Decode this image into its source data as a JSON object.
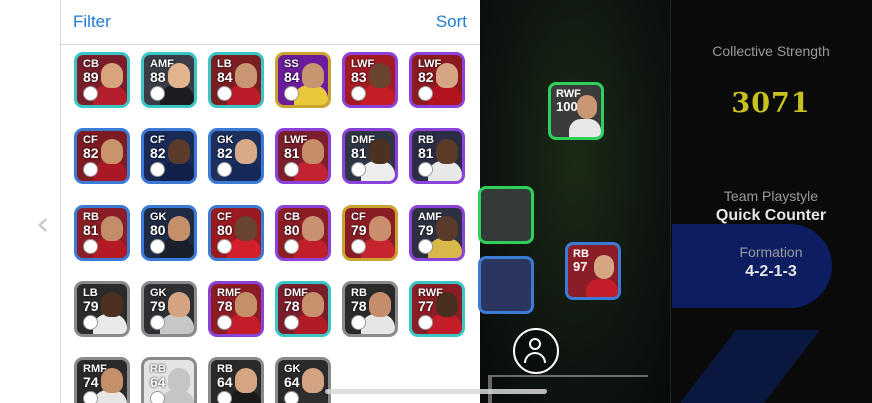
{
  "panel": {
    "filter_label": "Filter",
    "sort_label": "Sort"
  },
  "cards": [
    {
      "pos": "CB",
      "ovr": "89",
      "frame": "#3ac5c6",
      "bg": "#7a1d2a",
      "skin": "#d8a47e",
      "kit": "#b51e2c"
    },
    {
      "pos": "AMF",
      "ovr": "88",
      "frame": "#3ac5c6",
      "bg": "#3a3d47",
      "skin": "#e1b48e",
      "kit": "#1a1c22"
    },
    {
      "pos": "LB",
      "ovr": "84",
      "frame": "#3ac5c6",
      "bg": "#7a1e22",
      "skin": "#c99572",
      "kit": "#b91c28"
    },
    {
      "pos": "SS",
      "ovr": "84",
      "frame": "#c9a430",
      "bg": "#6a1c9a",
      "skin": "#c79570",
      "kit": "#e8c93a"
    },
    {
      "pos": "LWF",
      "ovr": "83",
      "frame": "#8b42d8",
      "bg": "#a31a22",
      "skin": "#6b4430",
      "kit": "#c41d26"
    },
    {
      "pos": "LWF",
      "ovr": "82",
      "frame": "#8b42d8",
      "bg": "#8c1a20",
      "skin": "#d6a684",
      "kit": "#b3131f"
    },
    {
      "pos": "CF",
      "ovr": "82",
      "frame": "#3b7bd6",
      "bg": "#7d1a22",
      "skin": "#c9946c",
      "kit": "#a91824"
    },
    {
      "pos": "CF",
      "ovr": "82",
      "frame": "#3b7bd6",
      "bg": "#182a55",
      "skin": "#5a3a28",
      "kit": "#10204a"
    },
    {
      "pos": "GK",
      "ovr": "82",
      "frame": "#3b7bd6",
      "bg": "#1d2f5c",
      "skin": "#d9aa88",
      "kit": "#14285a"
    },
    {
      "pos": "LWF",
      "ovr": "81",
      "frame": "#8b42d8",
      "bg": "#7c1e2c",
      "skin": "#c58d68",
      "kit": "#c12430"
    },
    {
      "pos": "DMF",
      "ovr": "81",
      "frame": "#8b42d8",
      "bg": "#303545",
      "skin": "#4c3020",
      "kit": "#eeeeee"
    },
    {
      "pos": "RB",
      "ovr": "81",
      "frame": "#8b42d8",
      "bg": "#2a2d44",
      "skin": "#5c3a28",
      "kit": "#e8e8e8"
    },
    {
      "pos": "RB",
      "ovr": "81",
      "frame": "#3b7bd6",
      "bg": "#8a1d25",
      "skin": "#c48d6a",
      "kit": "#b31a26"
    },
    {
      "pos": "GK",
      "ovr": "80",
      "frame": "#3b7bd6",
      "bg": "#1f2a45",
      "skin": "#c58f6a",
      "kit": "#1a1f2c"
    },
    {
      "pos": "CF",
      "ovr": "80",
      "frame": "#3b7bd6",
      "bg": "#9a1a22",
      "skin": "#6a4432",
      "kit": "#d21f2a"
    },
    {
      "pos": "CB",
      "ovr": "80",
      "frame": "#8b42d8",
      "bg": "#8c1d25",
      "skin": "#c89270",
      "kit": "#c01e28"
    },
    {
      "pos": "CF",
      "ovr": "79",
      "frame": "#c9a430",
      "bg": "#8a1c24",
      "skin": "#c98f6c",
      "kit": "#c62530"
    },
    {
      "pos": "AMF",
      "ovr": "79",
      "frame": "#8b42d8",
      "bg": "#2c3040",
      "skin": "#5a3a2a",
      "kit": "#d8b84a"
    },
    {
      "pos": "LB",
      "ovr": "79",
      "frame": "#8a8a8a",
      "bg": "#2b2b2b",
      "skin": "#4e3020",
      "kit": "#eaeaea"
    },
    {
      "pos": "GK",
      "ovr": "79",
      "frame": "#8a8a8a",
      "bg": "#2e2e33",
      "skin": "#d4a482",
      "kit": "#c7c7c7"
    },
    {
      "pos": "RMF",
      "ovr": "78",
      "frame": "#8b42d8",
      "bg": "#8c1d25",
      "skin": "#c58f6a",
      "kit": "#c21d28"
    },
    {
      "pos": "DMF",
      "ovr": "78",
      "frame": "#3ac5c6",
      "bg": "#7a1d2a",
      "skin": "#c8926e",
      "kit": "#b11b26"
    },
    {
      "pos": "RB",
      "ovr": "78",
      "frame": "#8a8a8a",
      "bg": "#2a2a2a",
      "skin": "#c48e6c",
      "kit": "#e6e6e6"
    },
    {
      "pos": "RWF",
      "ovr": "77",
      "frame": "#3ac5c6",
      "bg": "#8a1d25",
      "skin": "#4a2e20",
      "kit": "#c21d28"
    },
    {
      "pos": "RMF",
      "ovr": "74",
      "frame": "#8a8a8a",
      "bg": "#2a2a2a",
      "skin": "#c58f6a",
      "kit": "#e6e6e6"
    },
    {
      "pos": "RB",
      "ovr": "64",
      "frame": "#8a8a8a",
      "bg": "#e4e4e4",
      "skin": "#c5c5c5",
      "kit": "#c5c5c5"
    },
    {
      "pos": "RB",
      "ovr": "64",
      "frame": "#8a8a8a",
      "bg": "#2a2a2a",
      "skin": "#d6a684",
      "kit": "#1a1a1a"
    },
    {
      "pos": "GK",
      "ovr": "64",
      "frame": "#8a8a8a",
      "bg": "#2a2a2a",
      "skin": "#d4a482",
      "kit": "#2e2e2e"
    }
  ],
  "pitch": {
    "rwf": {
      "pos": "RWF",
      "ovr": "100"
    },
    "rb": {
      "pos": "RB",
      "ovr": "97"
    }
  },
  "info": {
    "collective_label": "Collective Strength",
    "strength_value": "3071",
    "playstyle_label": "Team Playstyle",
    "playstyle_value": "Quick Counter",
    "formation_label": "Formation",
    "formation_value": "4-2-1-3",
    "accent": "#c7c220"
  }
}
